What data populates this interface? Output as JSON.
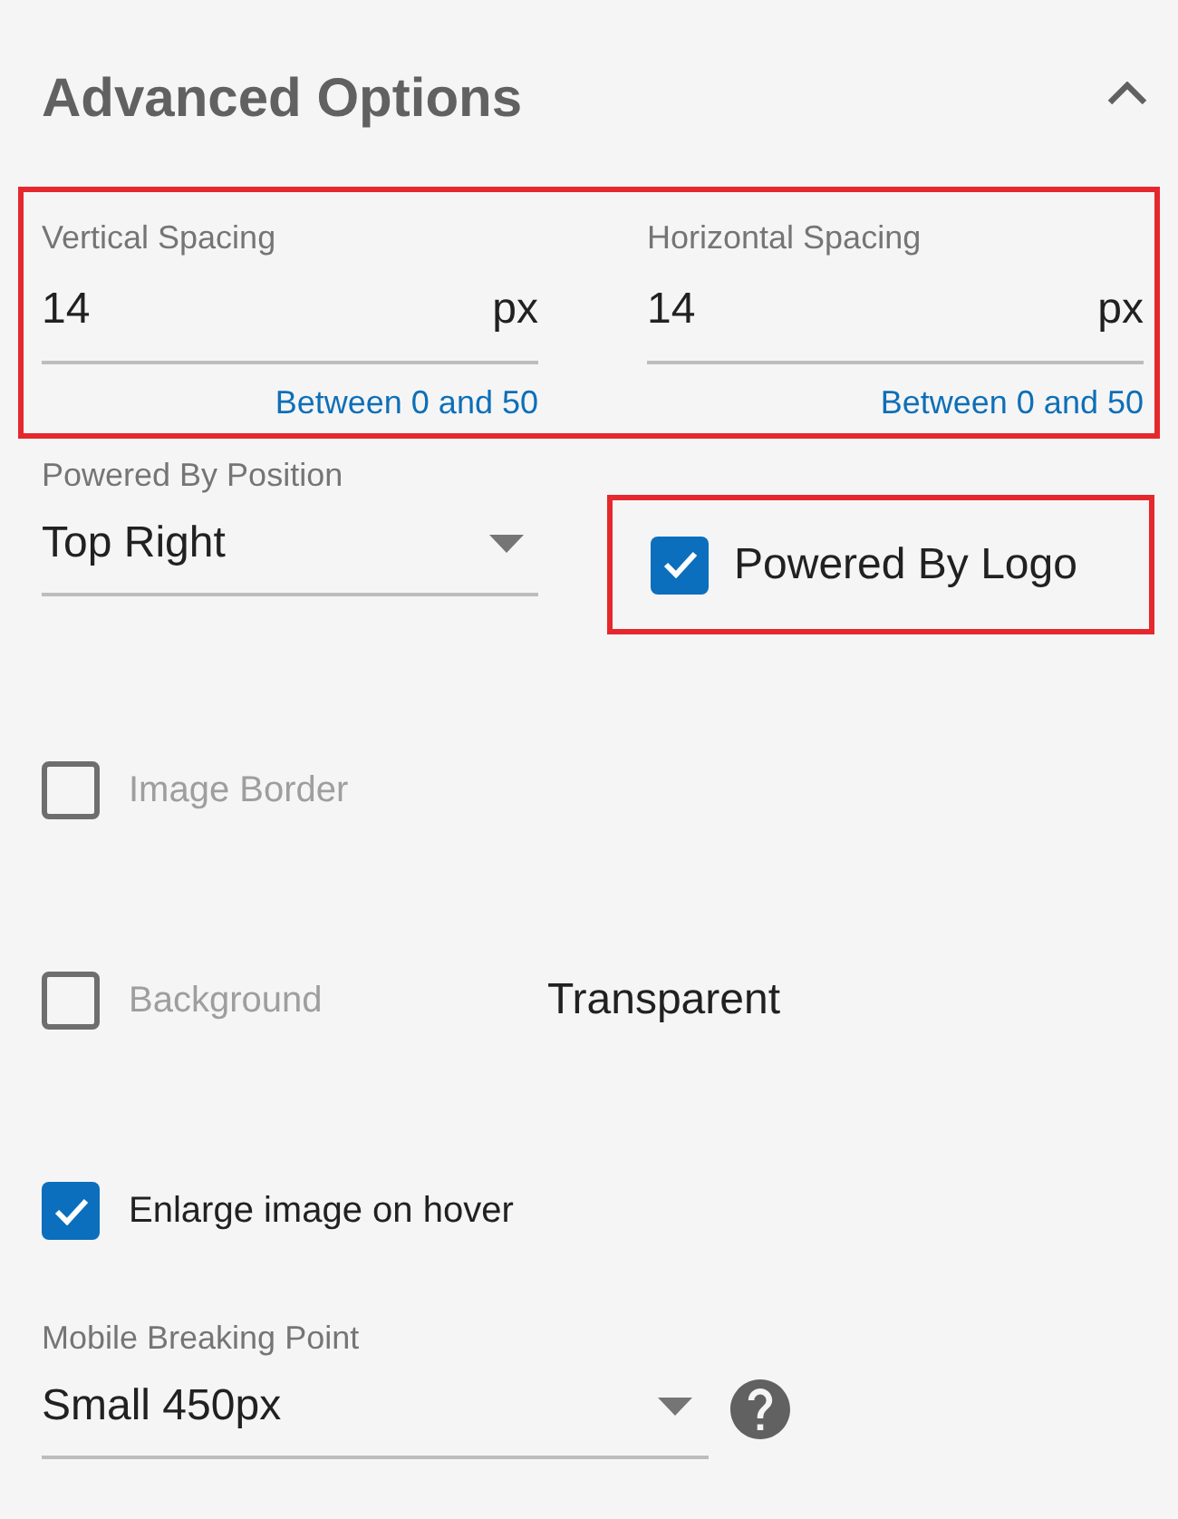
{
  "section": {
    "title": "Advanced Options",
    "expanded": true
  },
  "spacing_group": {
    "highlighted": true,
    "fields": [
      {
        "label": "Vertical Spacing",
        "value": "14",
        "unit": "px",
        "helper": "Between 0 and 50"
      },
      {
        "label": "Horizontal Spacing",
        "value": "14",
        "unit": "px",
        "helper": "Between 0 and 50"
      }
    ]
  },
  "powered_by_position": {
    "label": "Powered By Position",
    "value": "Top Right"
  },
  "powered_by_logo": {
    "label": "Powered By Logo",
    "checked": true,
    "highlighted": true
  },
  "image_border": {
    "label": "Image Border",
    "checked": false,
    "disabled": true
  },
  "background": {
    "label": "Background",
    "checked": false,
    "disabled": true,
    "value": "Transparent"
  },
  "enlarge_on_hover": {
    "label": "Enlarge image on hover",
    "checked": true,
    "disabled": false
  },
  "mobile_breaking_point": {
    "label": "Mobile Breaking Point",
    "value": "Small 450px"
  }
}
